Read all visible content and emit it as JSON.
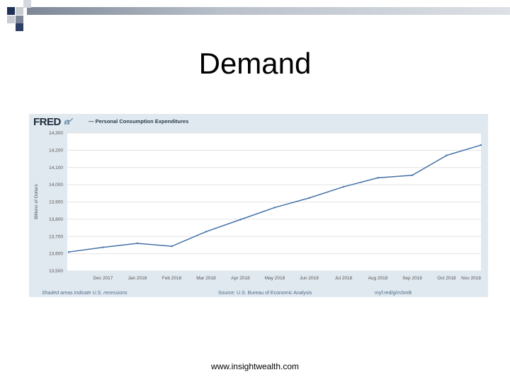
{
  "slide": {
    "title": "Demand",
    "footer": "www.insightwealth.com"
  },
  "fred": {
    "logo": "FRED",
    "source": "Source: U.S. Bureau of Economic Analysis",
    "recession_note": "Shaded areas indicate U.S. recessions",
    "shortlink": "myf.red/g/mSmB"
  },
  "chart_data": {
    "type": "line",
    "title": "— Personal Consumption Expenditures",
    "ylabel": "Billions of Dollars",
    "xlabel": "",
    "ylim": [
      13500,
      14300
    ],
    "yticks": [
      13500,
      13600,
      13700,
      13800,
      13900,
      14000,
      14100,
      14200,
      14300
    ],
    "ytick_labels": [
      "13,500",
      "13,600",
      "13,700",
      "13,800",
      "13,900",
      "14,000",
      "14,100",
      "14,200",
      "14,300"
    ],
    "x_labels": [
      "Dec 2017",
      "Jan 2018",
      "Feb 2018",
      "Mar 2018",
      "Apr 2018",
      "May 2018",
      "Jun 2018",
      "Jul 2018",
      "Aug 2018",
      "Sep 2018",
      "Oct 2018",
      "Nov 2018"
    ],
    "grid": true,
    "legend": "top-left",
    "series": [
      {
        "name": "Personal Consumption Expenditures",
        "color": "#4572a7",
        "x": [
          "Nov 2017",
          "Dec 2017",
          "Jan 2018",
          "Feb 2018",
          "Mar 2018",
          "Apr 2018",
          "May 2018",
          "Jun 2018",
          "Jul 2018",
          "Aug 2018",
          "Sep 2018",
          "Oct 2018",
          "Nov 2018"
        ],
        "values": [
          13610,
          13637,
          13660,
          13643,
          13728,
          13798,
          13868,
          13923,
          13988,
          14040,
          14055,
          14170,
          14230
        ]
      }
    ]
  }
}
